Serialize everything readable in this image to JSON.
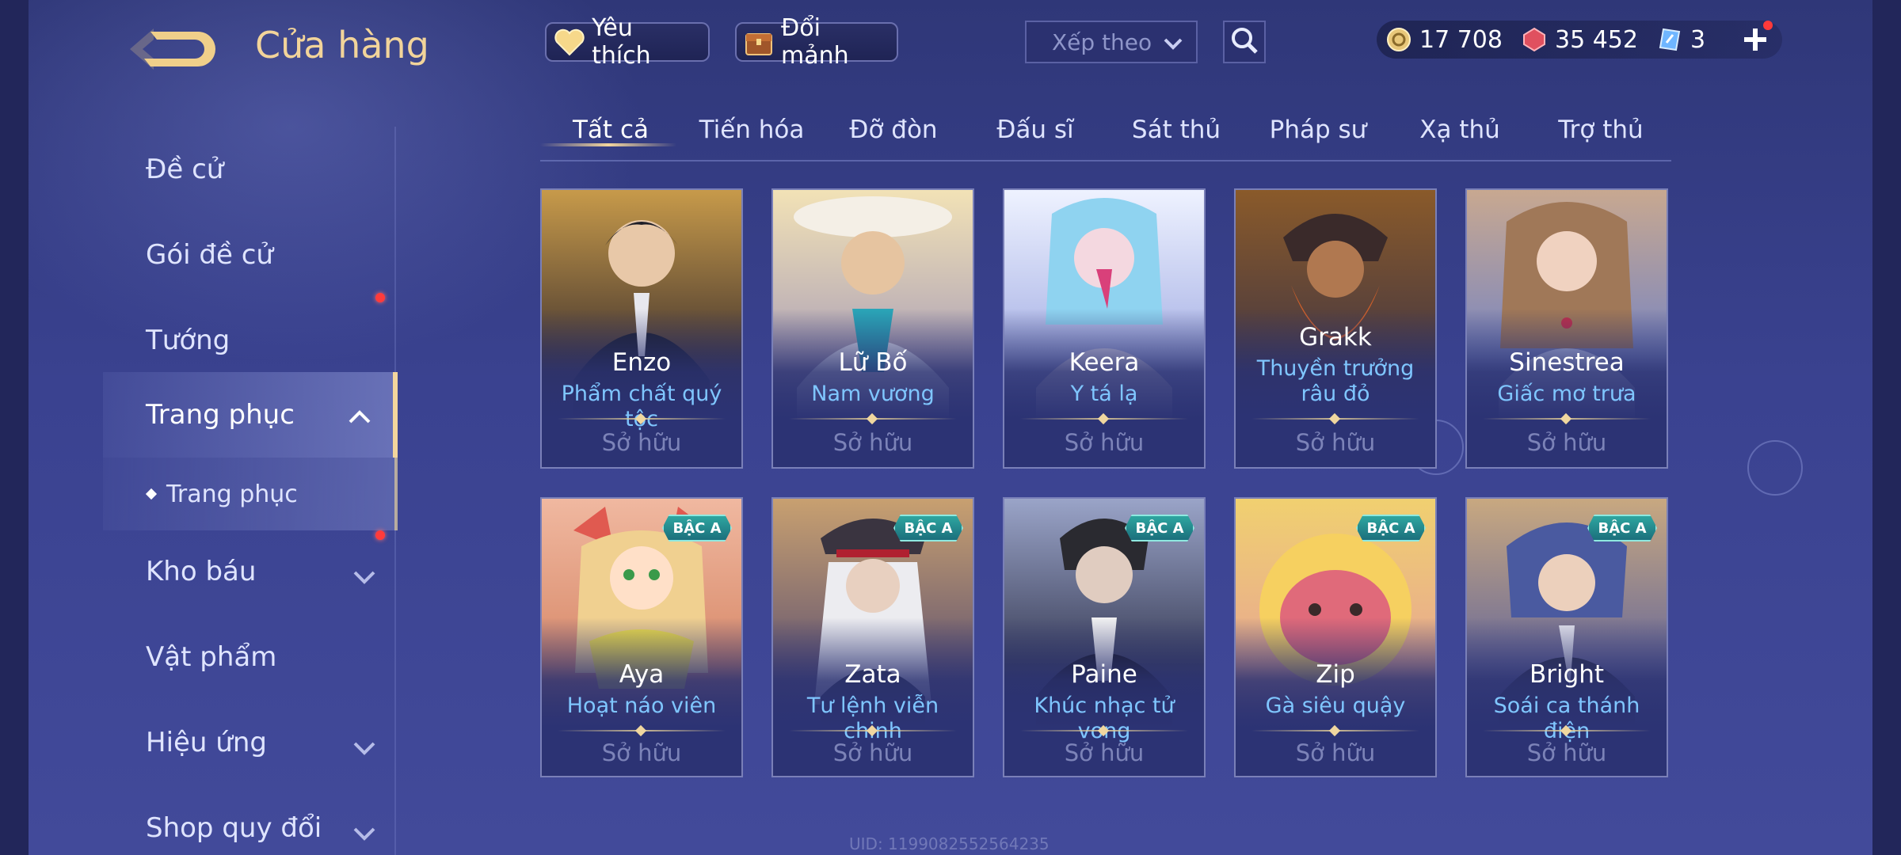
{
  "header": {
    "title": "Cửa hàng",
    "favorite_label": "Yêu thích",
    "shard_label": "Đổi mảnh",
    "sort_placeholder": "Xếp theo"
  },
  "currency": [
    {
      "name": "gold",
      "value": "17 708",
      "color": "#e8c77a"
    },
    {
      "name": "ruby",
      "value": "35 452",
      "color": "#e0505f"
    },
    {
      "name": "voucher",
      "value": "3",
      "color": "#6fb6ff"
    }
  ],
  "sidebar": {
    "items": [
      {
        "label": "Đề cử"
      },
      {
        "label": "Gói đề cử"
      },
      {
        "label": "Tướng"
      },
      {
        "label": "Trang phục"
      },
      {
        "label": "Trang phục"
      },
      {
        "label": "Kho báu"
      },
      {
        "label": "Vật phẩm"
      },
      {
        "label": "Hiệu ứng"
      },
      {
        "label": "Shop quy đổi"
      }
    ]
  },
  "tabs": [
    "Tất cả",
    "Tiến hóa",
    "Đỡ đòn",
    "Đấu sĩ",
    "Sát thủ",
    "Pháp sư",
    "Xạ thủ",
    "Trợ thủ"
  ],
  "cards": [
    {
      "hero": "Enzo",
      "skin": "Phẩm chất quý tộc",
      "status": "Sở hữu",
      "tier": ""
    },
    {
      "hero": "Lữ Bố",
      "skin": "Nam vương",
      "status": "Sở hữu",
      "tier": ""
    },
    {
      "hero": "Keera",
      "skin": "Y tá lạ",
      "status": "Sở hữu",
      "tier": ""
    },
    {
      "hero": "Grakk",
      "skin": "Thuyền trưởng râu đỏ",
      "status": "Sở hữu",
      "tier": ""
    },
    {
      "hero": "Sinestrea",
      "skin": "Giấc mơ trưa",
      "status": "Sở hữu",
      "tier": ""
    },
    {
      "hero": "Aya",
      "skin": "Hoạt náo viên",
      "status": "Sở hữu",
      "tier": "BẬC A"
    },
    {
      "hero": "Zata",
      "skin": "Tư lệnh viễn chinh",
      "status": "Sở hữu",
      "tier": "BẬC A"
    },
    {
      "hero": "Paine",
      "skin": "Khúc nhạc tử vong",
      "status": "Sở hữu",
      "tier": "BẬC A"
    },
    {
      "hero": "Zip",
      "skin": "Gà siêu quậy",
      "status": "Sở hữu",
      "tier": "BẬC A"
    },
    {
      "hero": "Bright",
      "skin": "Soái ca thánh điện",
      "status": "Sở hữu",
      "tier": "BẬC A"
    }
  ],
  "uid": "UID: 1199082552564235"
}
